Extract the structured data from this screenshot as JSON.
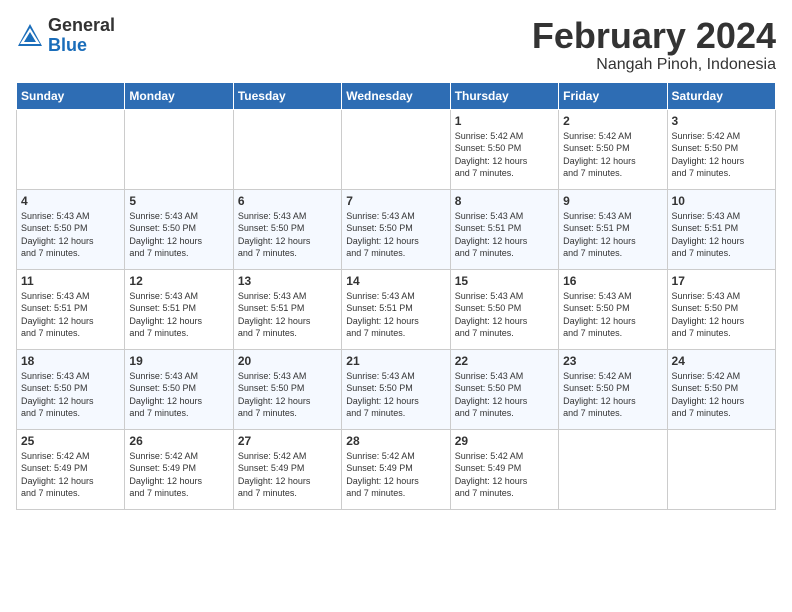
{
  "header": {
    "logo_general": "General",
    "logo_blue": "Blue",
    "month_title": "February 2024",
    "location": "Nangah Pinoh, Indonesia"
  },
  "days_of_week": [
    "Sunday",
    "Monday",
    "Tuesday",
    "Wednesday",
    "Thursday",
    "Friday",
    "Saturday"
  ],
  "weeks": [
    [
      {
        "day": "",
        "info": ""
      },
      {
        "day": "",
        "info": ""
      },
      {
        "day": "",
        "info": ""
      },
      {
        "day": "",
        "info": ""
      },
      {
        "day": "1",
        "info": "Sunrise: 5:42 AM\nSunset: 5:50 PM\nDaylight: 12 hours\nand 7 minutes."
      },
      {
        "day": "2",
        "info": "Sunrise: 5:42 AM\nSunset: 5:50 PM\nDaylight: 12 hours\nand 7 minutes."
      },
      {
        "day": "3",
        "info": "Sunrise: 5:42 AM\nSunset: 5:50 PM\nDaylight: 12 hours\nand 7 minutes."
      }
    ],
    [
      {
        "day": "4",
        "info": "Sunrise: 5:43 AM\nSunset: 5:50 PM\nDaylight: 12 hours\nand 7 minutes."
      },
      {
        "day": "5",
        "info": "Sunrise: 5:43 AM\nSunset: 5:50 PM\nDaylight: 12 hours\nand 7 minutes."
      },
      {
        "day": "6",
        "info": "Sunrise: 5:43 AM\nSunset: 5:50 PM\nDaylight: 12 hours\nand 7 minutes."
      },
      {
        "day": "7",
        "info": "Sunrise: 5:43 AM\nSunset: 5:50 PM\nDaylight: 12 hours\nand 7 minutes."
      },
      {
        "day": "8",
        "info": "Sunrise: 5:43 AM\nSunset: 5:51 PM\nDaylight: 12 hours\nand 7 minutes."
      },
      {
        "day": "9",
        "info": "Sunrise: 5:43 AM\nSunset: 5:51 PM\nDaylight: 12 hours\nand 7 minutes."
      },
      {
        "day": "10",
        "info": "Sunrise: 5:43 AM\nSunset: 5:51 PM\nDaylight: 12 hours\nand 7 minutes."
      }
    ],
    [
      {
        "day": "11",
        "info": "Sunrise: 5:43 AM\nSunset: 5:51 PM\nDaylight: 12 hours\nand 7 minutes."
      },
      {
        "day": "12",
        "info": "Sunrise: 5:43 AM\nSunset: 5:51 PM\nDaylight: 12 hours\nand 7 minutes."
      },
      {
        "day": "13",
        "info": "Sunrise: 5:43 AM\nSunset: 5:51 PM\nDaylight: 12 hours\nand 7 minutes."
      },
      {
        "day": "14",
        "info": "Sunrise: 5:43 AM\nSunset: 5:51 PM\nDaylight: 12 hours\nand 7 minutes."
      },
      {
        "day": "15",
        "info": "Sunrise: 5:43 AM\nSunset: 5:50 PM\nDaylight: 12 hours\nand 7 minutes."
      },
      {
        "day": "16",
        "info": "Sunrise: 5:43 AM\nSunset: 5:50 PM\nDaylight: 12 hours\nand 7 minutes."
      },
      {
        "day": "17",
        "info": "Sunrise: 5:43 AM\nSunset: 5:50 PM\nDaylight: 12 hours\nand 7 minutes."
      }
    ],
    [
      {
        "day": "18",
        "info": "Sunrise: 5:43 AM\nSunset: 5:50 PM\nDaylight: 12 hours\nand 7 minutes."
      },
      {
        "day": "19",
        "info": "Sunrise: 5:43 AM\nSunset: 5:50 PM\nDaylight: 12 hours\nand 7 minutes."
      },
      {
        "day": "20",
        "info": "Sunrise: 5:43 AM\nSunset: 5:50 PM\nDaylight: 12 hours\nand 7 minutes."
      },
      {
        "day": "21",
        "info": "Sunrise: 5:43 AM\nSunset: 5:50 PM\nDaylight: 12 hours\nand 7 minutes."
      },
      {
        "day": "22",
        "info": "Sunrise: 5:43 AM\nSunset: 5:50 PM\nDaylight: 12 hours\nand 7 minutes."
      },
      {
        "day": "23",
        "info": "Sunrise: 5:42 AM\nSunset: 5:50 PM\nDaylight: 12 hours\nand 7 minutes."
      },
      {
        "day": "24",
        "info": "Sunrise: 5:42 AM\nSunset: 5:50 PM\nDaylight: 12 hours\nand 7 minutes."
      }
    ],
    [
      {
        "day": "25",
        "info": "Sunrise: 5:42 AM\nSunset: 5:49 PM\nDaylight: 12 hours\nand 7 minutes."
      },
      {
        "day": "26",
        "info": "Sunrise: 5:42 AM\nSunset: 5:49 PM\nDaylight: 12 hours\nand 7 minutes."
      },
      {
        "day": "27",
        "info": "Sunrise: 5:42 AM\nSunset: 5:49 PM\nDaylight: 12 hours\nand 7 minutes."
      },
      {
        "day": "28",
        "info": "Sunrise: 5:42 AM\nSunset: 5:49 PM\nDaylight: 12 hours\nand 7 minutes."
      },
      {
        "day": "29",
        "info": "Sunrise: 5:42 AM\nSunset: 5:49 PM\nDaylight: 12 hours\nand 7 minutes."
      },
      {
        "day": "",
        "info": ""
      },
      {
        "day": "",
        "info": ""
      }
    ]
  ]
}
